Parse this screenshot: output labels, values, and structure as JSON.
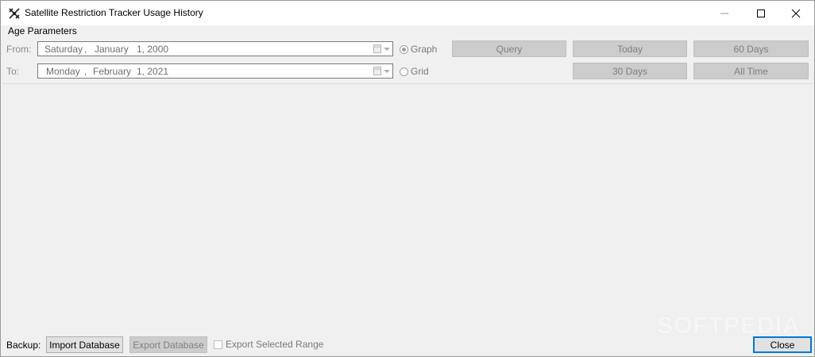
{
  "window": {
    "title": "Satellite Restriction Tracker Usage History",
    "icon": "satellite-icon",
    "controls": [
      "minimize-icon",
      "maximize-icon",
      "close-icon"
    ]
  },
  "parameters": {
    "group_label": "Age Parameters",
    "from": {
      "label": "From:",
      "weekday": "Saturday",
      "sep": ",",
      "month": "January",
      "day_year": "1, 2000"
    },
    "to": {
      "label": "To:",
      "weekday": "Monday",
      "sep": ",",
      "month": "February",
      "day_year": "1, 2021"
    },
    "view_modes": [
      {
        "label": "Graph",
        "selected": true
      },
      {
        "label": "Grid",
        "selected": false
      }
    ],
    "buttons": {
      "query": "Query",
      "today": "Today",
      "days60": "60 Days",
      "days30": "30 Days",
      "all_time": "All Time"
    }
  },
  "footer": {
    "backup_label": "Backup:",
    "import_button": "Import Database",
    "export_button": "Export Database",
    "export_selected_label": "Export Selected Range",
    "export_selected_checked": false,
    "close_button": "Close"
  },
  "watermark": "SOFTPEDIA",
  "colors": {
    "accent": "#0078d7",
    "disabled_button": "#cccccc",
    "window_bg": "#f0f0f0"
  }
}
